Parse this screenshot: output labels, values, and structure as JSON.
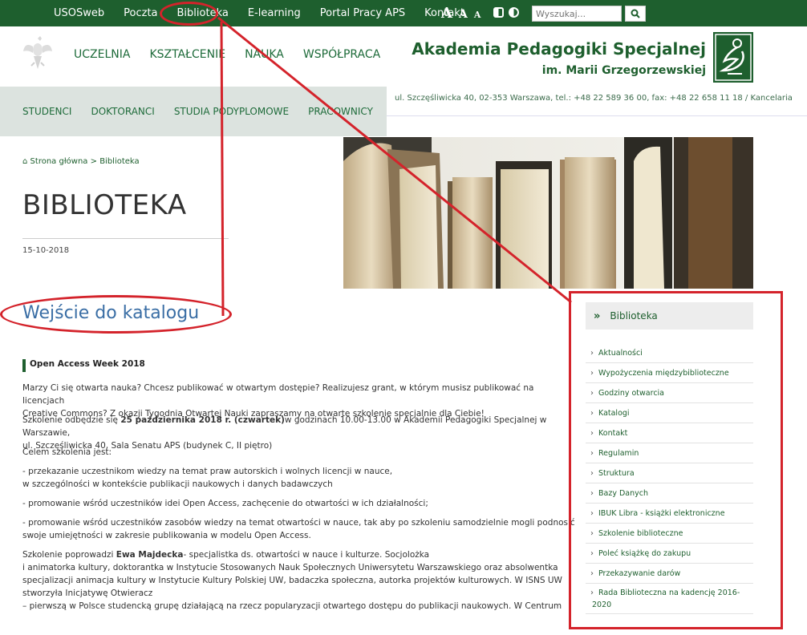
{
  "topbar": {
    "nav": [
      "USOSweb",
      "Poczta",
      "Biblioteka",
      "E-learning",
      "Portal Pracy APS",
      "Kontakt"
    ],
    "font_sizes": [
      "A",
      "A",
      "A"
    ],
    "search_placeholder": "Wyszukaj..."
  },
  "header": {
    "main_nav": [
      "UCZELNIA",
      "KSZTAŁCENIE",
      "NAUKA",
      "WSPÓŁPRACA"
    ],
    "brand_line1": "Akademia Pedagogiki Specjalnej",
    "brand_line2": "im. Marii Grzegorzewskiej"
  },
  "subnav": {
    "items": [
      "STUDENCI",
      "DOKTORANCI",
      "STUDIA PODYPLOMOWE",
      "PRACOWNICY"
    ]
  },
  "address": "ul. Szczęśliwicka 40, 02-353 Warszawa, tel.: +48 22 589 36 00, fax: +48 22 658 11 18 / Kancelaria",
  "breadcrumb": {
    "home": "Strona główna",
    "separator": ">",
    "current": "Biblioteka"
  },
  "page": {
    "title": "BIBLIOTEKA",
    "date": "15-10-2018",
    "catalog_link": "Wejście do katalogu"
  },
  "article": {
    "heading": "Open Access Week 2018",
    "p1_l1": "Marzy Ci się otwarta nauka? Chcesz publikować  w otwartym dostępie? Realizujesz grant, w którym musisz publikować na licencjach",
    "p1_l2": "Creative Commons? Z okazji Tygodnia Otwartej Nauki zapraszamy na otwarte szkolenie specjalnie dla Ciebie!",
    "p2_a": "Szkolenie odbędzie się ",
    "p2_b": "25 października 2018 r. (czwartek)",
    "p2_c": "w godzinach 10.00-13.00 w Akademii Pedagogiki Specjalnej w Warszawie,",
    "p2_l2": "ul. Szczęśliwicka 40, Sala Senatu APS (budynek C, II piętro)",
    "p3": "Celem szkolenia jest:",
    "p4_l1": "- przekazanie uczestnikom wiedzy na temat praw autorskich i wolnych licencji w nauce,",
    "p4_l2": "w szczególności w kontekście publikacji naukowych i danych badawczych",
    "p5": "- promowanie wśród uczestników idei Open Access, zachęcenie do otwartości w ich działalności;",
    "p6_l1": "- promowanie wśród uczestników zasobów wiedzy na temat otwartości w nauce, tak aby po szkoleniu samodzielnie mogli podnosić",
    "p6_l2": "swoje umiejętności w zakresie publikowania w modelu Open Access.",
    "p7_a": "Szkolenie poprowadzi ",
    "p7_b": "Ewa Majdecka",
    "p7_c": "- specjalistka ds. otwartości w nauce i kulturze. Socjolożka",
    "p7_l2": "i animatorka kultury, doktorantka w Instytucie Stosowanych Nauk Społecznych Uniwersytetu Warszawskiego oraz absolwentka",
    "p7_l3": "specjalizacji animacja kultury w Instytucie Kultury Polskiej UW, badaczka społeczna, autorka projektów kulturowych. W ISNS UW",
    "p7_l4": "stworzyła Inicjatywę Otwieracz",
    "p7_l5": " – pierwszą w Polsce studencką grupę działającą na rzecz popularyzacji otwartego dostępu do publikacji naukowych. W Centrum"
  },
  "sidebar": {
    "title": "Biblioteka",
    "items": [
      "Aktualności",
      "Wypożyczenia międzybiblioteczne",
      "Godziny otwarcia",
      "Katalogi",
      "Kontakt",
      "Regulamin",
      "Struktura",
      "Bazy Danych",
      "IBUK Libra - książki elektroniczne",
      "Szkolenie biblioteczne",
      "Poleć książkę do zakupu",
      "Przekazywanie darów",
      "Rada Biblioteczna na kadencję 2016-2020"
    ]
  },
  "colors": {
    "brand_green": "#1e5f2e",
    "highlight_red": "#d4232b",
    "link_blue": "#3a6ea5"
  }
}
